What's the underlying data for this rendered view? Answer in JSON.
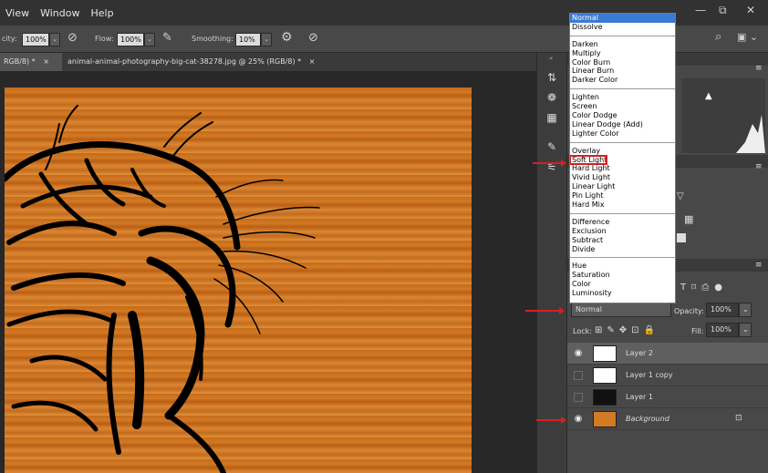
{
  "menu": {
    "items": [
      "View",
      "Window",
      "Help"
    ]
  },
  "window_controls": {
    "minimize": "—",
    "restore": "⧉",
    "close": "✕"
  },
  "options": {
    "opacity_label": "city:",
    "opacity_value": "100%",
    "flow_label": "Flow:",
    "flow_value": "100%",
    "smoothing_label": "Smoothing:",
    "smoothing_value": "10%"
  },
  "tabs": [
    {
      "label": "RGB/8) *",
      "close": "×"
    },
    {
      "label": "animal-animal-photography-big-cat-38278.jpg @ 25% (RGB/8) *",
      "close": "×"
    }
  ],
  "blend_modes": {
    "groups": [
      [
        "Normal",
        "Dissolve"
      ],
      [
        "Darken",
        "Multiply",
        "Color Burn",
        "Linear Burn",
        "Darker Color"
      ],
      [
        "Lighten",
        "Screen",
        "Color Dodge",
        "Linear Dodge (Add)",
        "Lighter Color"
      ],
      [
        "Overlay",
        "Soft Light",
        "Hard Light",
        "Vivid Light",
        "Linear Light",
        "Pin Light",
        "Hard Mix"
      ],
      [
        "Difference",
        "Exclusion",
        "Subtract",
        "Divide"
      ],
      [
        "Hue",
        "Saturation",
        "Color",
        "Luminosity"
      ]
    ],
    "selected": "Normal",
    "highlighted": "Soft Light"
  },
  "layers_panel": {
    "blend_mode": "Normal",
    "opacity_label": "Opacity:",
    "opacity_value": "100%",
    "lock_label": "Lock:",
    "fill_label": "Fill:",
    "fill_value": "100%",
    "layers": [
      {
        "name": "Layer 2",
        "visible": true,
        "active": true
      },
      {
        "name": "Layer 1 copy",
        "visible": false,
        "active": false
      },
      {
        "name": "Layer 1",
        "visible": false,
        "active": false
      },
      {
        "name": "Background",
        "visible": true,
        "active": false,
        "locked": true
      }
    ]
  },
  "colors": {
    "accent": "#3a7bd5",
    "annotation": "#d62020",
    "wood": "#d37a24"
  }
}
